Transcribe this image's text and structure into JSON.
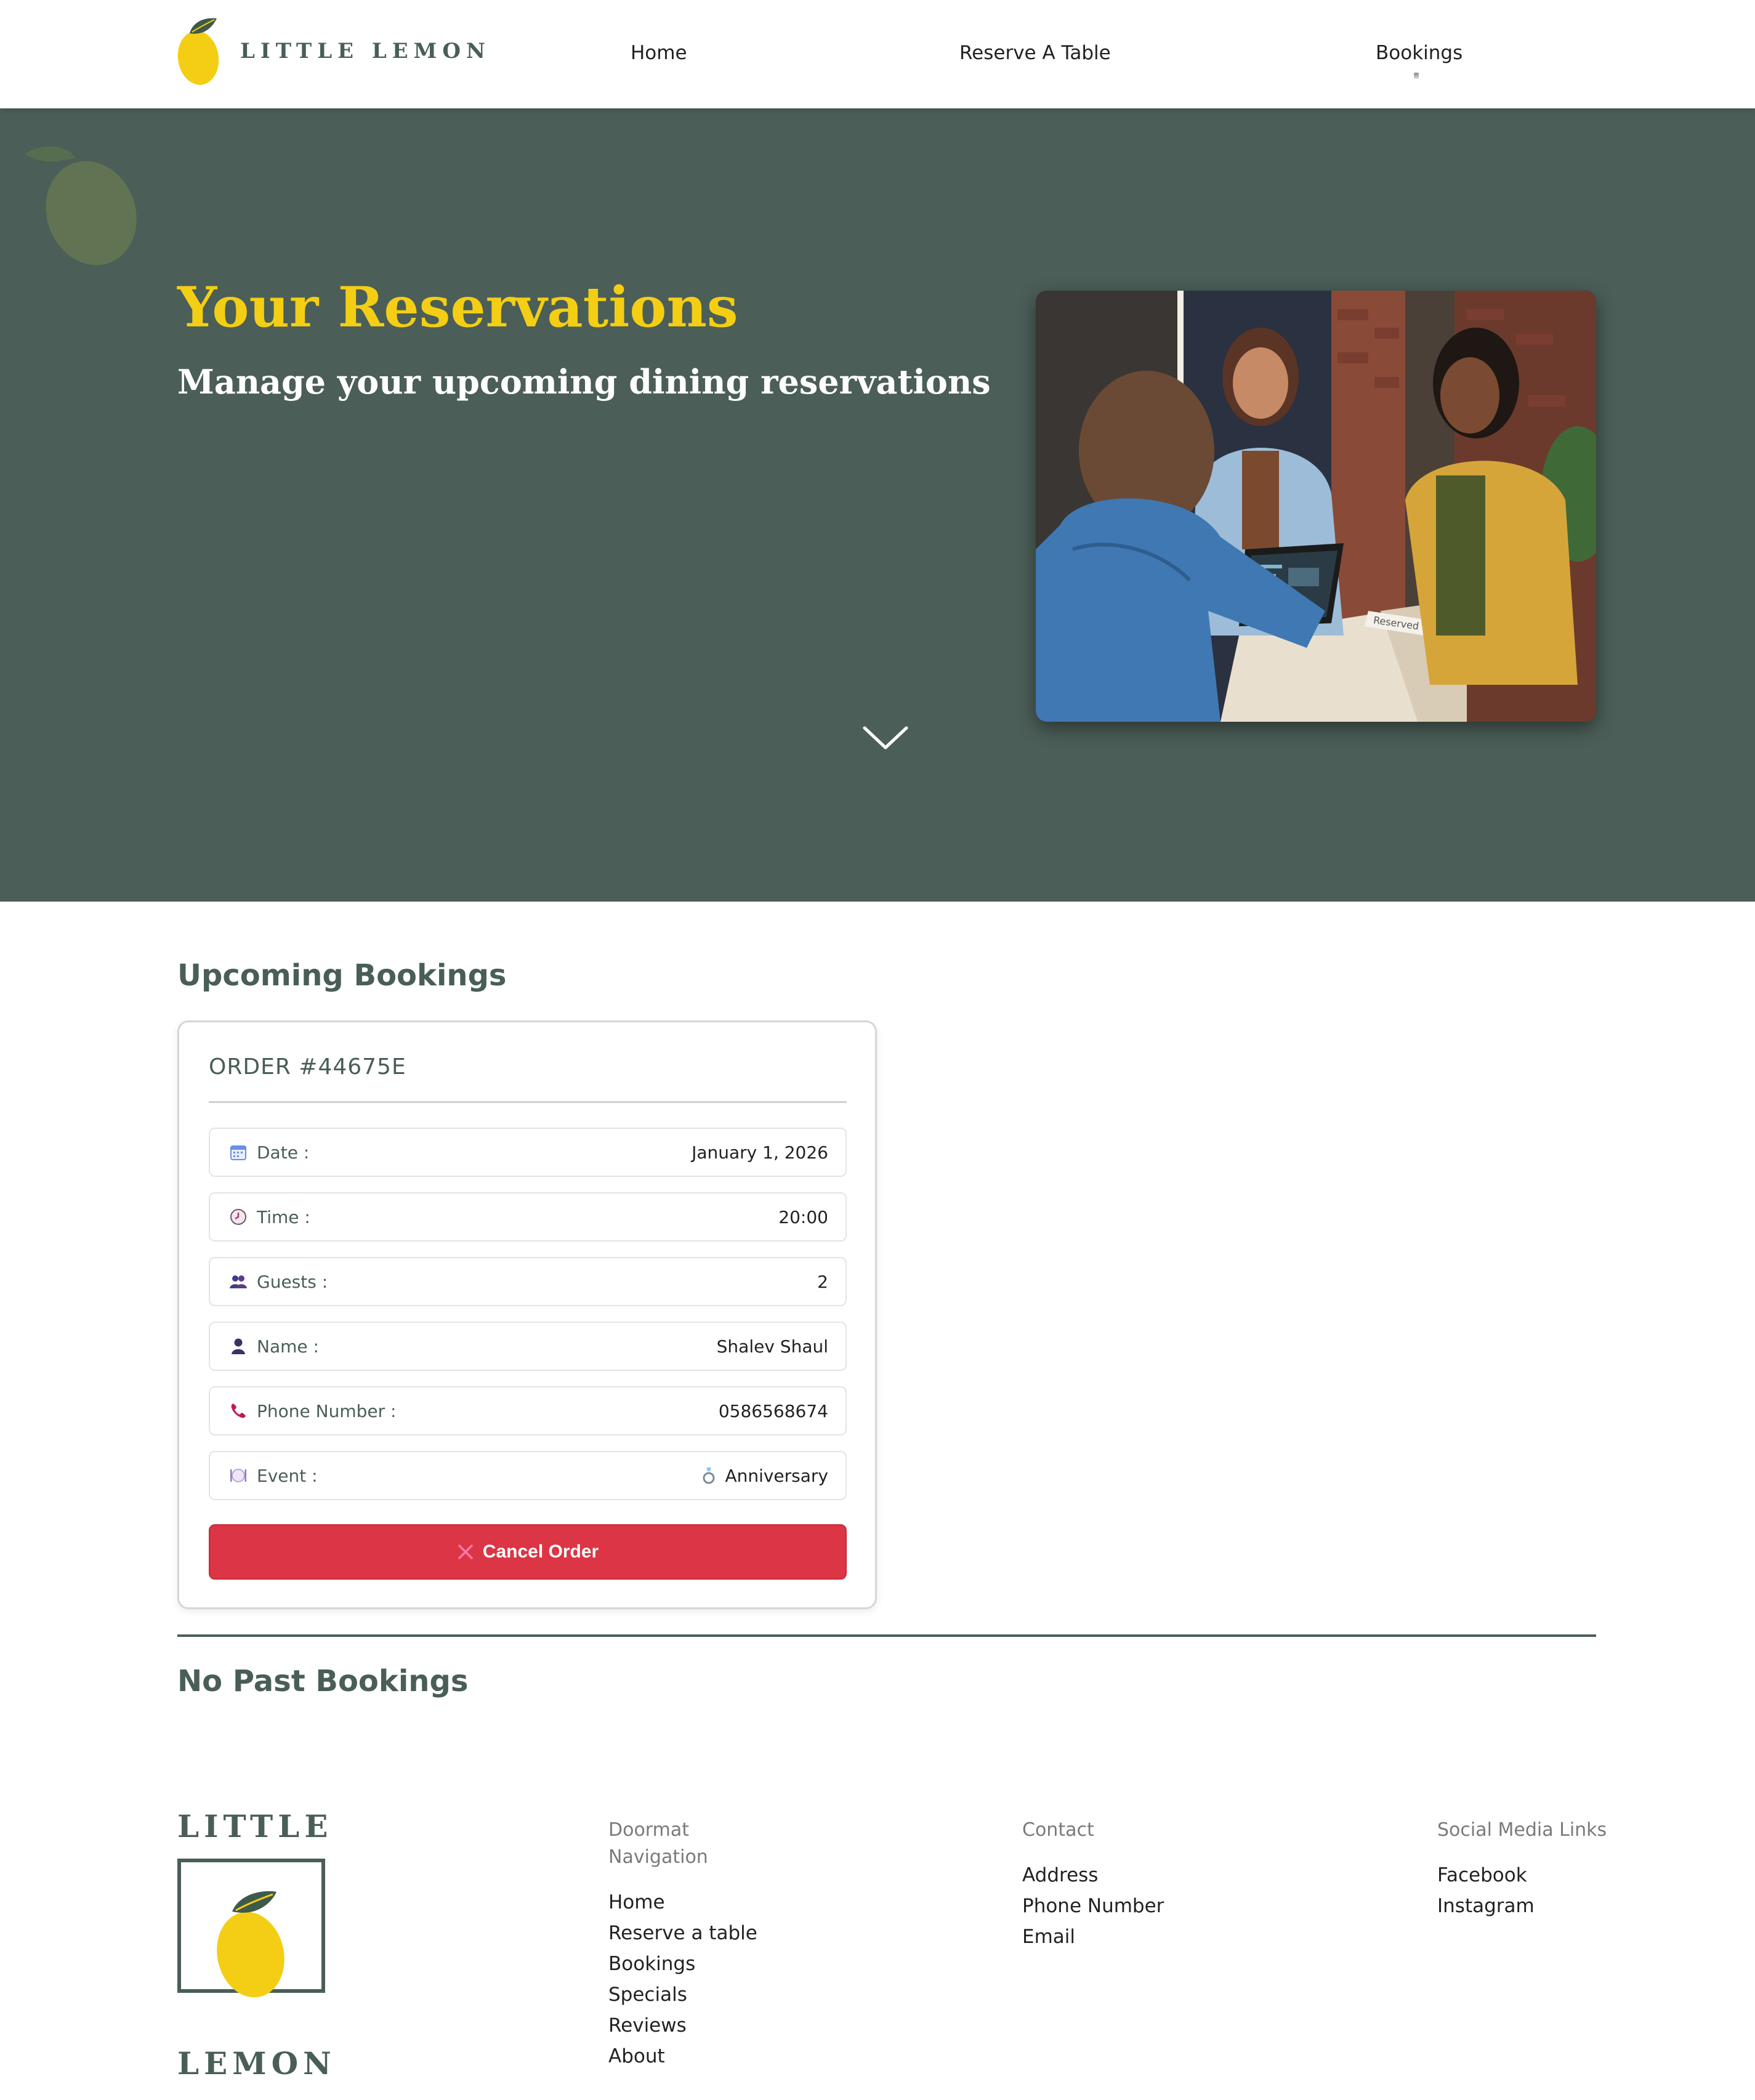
{
  "header": {
    "logo_text": "LITTLE LEMON",
    "nav": [
      "Home",
      "Reserve A Table",
      "Bookings"
    ]
  },
  "hero": {
    "title": "Your Reservations",
    "subtitle": "Manage your upcoming dining reservations",
    "photo_label": "Reserved",
    "photo_icon": "hostess-tablet-photo",
    "scroll_icon": "chevron-down-icon"
  },
  "upcoming": {
    "title": "Upcoming Bookings",
    "order": {
      "title": "ORDER #44675E",
      "rows": [
        {
          "icon": "calendar-icon",
          "label": "Date :",
          "value": "January 1, 2026"
        },
        {
          "icon": "clock-icon",
          "label": "Time :",
          "value": "20:00"
        },
        {
          "icon": "guests-icon",
          "label": "Guests :",
          "value": "2"
        },
        {
          "icon": "person-icon",
          "label": "Name :",
          "value": "Shalev Shaul"
        },
        {
          "icon": "phone-icon",
          "label": "Phone Number :",
          "value": "0586568674"
        },
        {
          "icon": "plate-icon",
          "label": "Event :",
          "value": "Anniversary",
          "value_icon": "ring-icon"
        }
      ],
      "cancel_label": "Cancel Order"
    }
  },
  "past": {
    "title": "No Past Bookings"
  },
  "footer": {
    "logo_top": "LITTLE",
    "logo_bottom": "LEMON",
    "nav_heading": "Doormat\nNavigation",
    "nav_links": [
      "Home",
      "Reserve a table",
      "Bookings",
      "Specials",
      "Reviews",
      "About"
    ],
    "contact_heading": "Contact",
    "contact_links": [
      "Address",
      "Phone Number",
      "Email"
    ],
    "social_heading": "Social Media Links",
    "social_links": [
      "Facebook",
      "Instagram"
    ]
  },
  "colors": {
    "brand_green": "#495e57",
    "brand_yellow": "#f4ce14",
    "danger": "#dc3545"
  }
}
